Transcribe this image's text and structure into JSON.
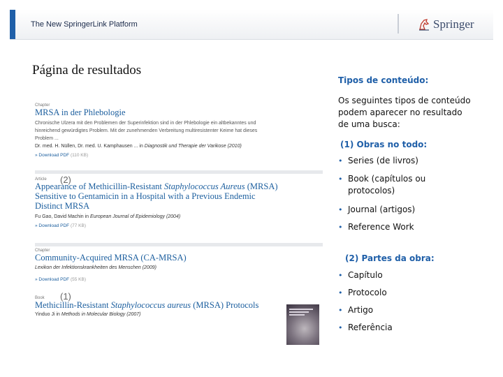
{
  "header": {
    "title": "The New SpringerLink Platform",
    "logo_text": "Springer"
  },
  "page_heading": "Página de resultados",
  "results": [
    {
      "type": "Chapter",
      "title": "MRSA in der Phlebologie",
      "snippet1": "Chronische Ulzera mit den Problemen der Superinfektion sind in der Phlebologie ein altbekanntes und",
      "snippet2": "hinreichend gewürdigtes Problem. Mit der zunehmenden Verbreitung multiresistenter Keime hat dieses",
      "snippet3": "Problem ...",
      "meta_authors": "Dr. med. H. Nüllen, Dr. med. U. Kamphausen ... in ",
      "meta_source": "Diagnostik und Therapie der Varikose (2010)",
      "download": "» Download PDF",
      "download_size": "(110 KB)"
    },
    {
      "type": "Article",
      "title_line1_pre": "Appearance of Methicillin-Resistant ",
      "title_line1_italic": "Staphylococcus Aureus",
      "title_line1_post": " (MRSA)",
      "title_line2": "Sensitive to Gentamicin in a Hospital with a Previous Endemic",
      "title_line3": "Distinct MRSA",
      "meta_authors": "Fu Gao, David Machin in ",
      "meta_source": "European Journal of Epidemiology (2004)",
      "download": "» Download PDF",
      "download_size": "(77 KB)"
    },
    {
      "type": "Chapter",
      "title": "Community-Acquired MRSA (CA-MRSA)",
      "meta_source": "Lexikon der Infektionskrankheiten des Menschen (2009)",
      "download": "» Download PDF",
      "download_size": "(55 KB)"
    },
    {
      "type": "Book",
      "title_pre": "Methicillin-Resistant ",
      "title_italic": "Staphylococcus aureus",
      "title_post": " (MRSA) Protocols",
      "meta_authors": "Yinduo Ji in ",
      "meta_source": "Methods in Molecular Biology (2007)"
    }
  ],
  "markers": {
    "article_marker": "(2)",
    "book_marker": "(1)"
  },
  "right_panel": {
    "heading": "Tipos de conteúdo:",
    "intro_line1": "Os seguintes tipos de conteúdo",
    "intro_line2": "podem aparecer no resultado",
    "intro_line3": "de uma busca:",
    "section1_title": "(1) Obras no todo:",
    "section1_items": [
      "Series (de livros)",
      "Book (capítulos ou",
      "protocolos)",
      "Journal (artigos)",
      "Reference Work"
    ],
    "section2_title": "(2) Partes da obra:",
    "section2_items": [
      "Capítulo",
      "Protocolo",
      "Artigo",
      "Referência"
    ],
    "bullet_char": "•"
  },
  "colors": {
    "accent": "#1f5fa8",
    "link": "#1b5e9e"
  }
}
